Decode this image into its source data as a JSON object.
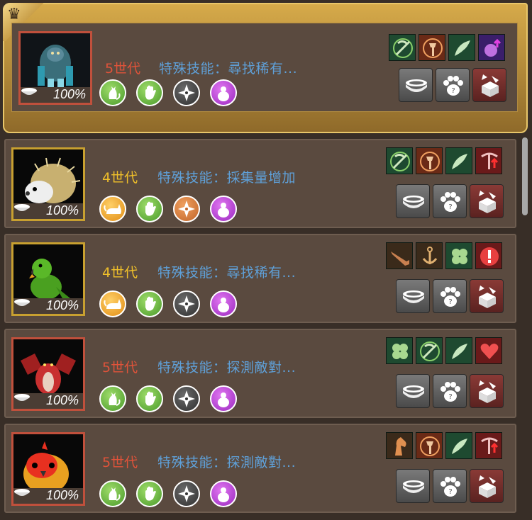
{
  "pets": [
    {
      "generation": "5世代",
      "skill": "特殊技能：尋找稀有...",
      "percent": "100%",
      "featured": true,
      "portrait_frame": "red",
      "gen_color": "red",
      "attrs": [
        "c-green",
        "c-green",
        "c-gray",
        "c-purple"
      ],
      "abilities": [
        "gather-green",
        "axe-orange",
        "wing-green",
        "bag-purple"
      ]
    },
    {
      "generation": "4世代",
      "skill": "特殊技能：採集量增加",
      "percent": "100%",
      "portrait_frame": "gold",
      "gen_color": "yel",
      "attrs": [
        "c-yellow",
        "c-green",
        "c-orange",
        "c-purple"
      ],
      "abilities": [
        "gather-green",
        "axe-orange",
        "wing-green",
        "pick-red"
      ]
    },
    {
      "generation": "4世代",
      "skill": "特殊技能：尋找稀有...",
      "percent": "100%",
      "portrait_frame": "gold",
      "gen_color": "yel",
      "attrs": [
        "c-yellow",
        "c-green",
        "c-gray",
        "c-purple"
      ],
      "abilities": [
        "gun-green",
        "anchor-green",
        "clover-green",
        "alert-red"
      ]
    },
    {
      "generation": "5世代",
      "skill": "特殊技能：探測敵對...",
      "percent": "100%",
      "portrait_frame": "red",
      "gen_color": "red",
      "attrs": [
        "c-green",
        "c-green",
        "c-gray",
        "c-purple"
      ],
      "abilities": [
        "clover-green",
        "gather-green",
        "wing-green",
        "heart-red"
      ]
    },
    {
      "generation": "5世代",
      "skill": "特殊技能：探測敵對...",
      "percent": "100%",
      "portrait_frame": "red",
      "gen_color": "red",
      "attrs": [
        "c-green",
        "c-green",
        "c-gray",
        "c-purple"
      ],
      "abilities": [
        "horse-orange",
        "axe-orange",
        "wing-green",
        "pick-red"
      ]
    }
  ],
  "colors": {
    "gen_red": "#e0533a",
    "gen_yellow": "#f0c02a",
    "skill_blue": "#5fa0d8",
    "card_bg": "#5a4a3f"
  }
}
